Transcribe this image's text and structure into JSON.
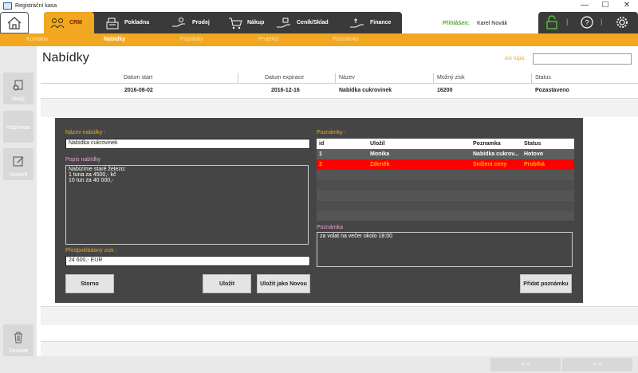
{
  "window": {
    "title": "Registrační kasa",
    "controls": [
      "—",
      "☐",
      "✕"
    ]
  },
  "topnav": {
    "items": [
      {
        "label": "CRM",
        "icon": "people-icon"
      },
      {
        "label": "Pokladna",
        "icon": "cash-register-icon"
      },
      {
        "label": "Prodej",
        "icon": "hand-coin-icon"
      },
      {
        "label": "Nákup",
        "icon": "cart-icon"
      },
      {
        "label": "Ceník/Sklad",
        "icon": "hand-box-icon"
      },
      {
        "label": "Finance",
        "icon": "hand-money-icon"
      }
    ],
    "login_label": "Přihlášen:",
    "login_name": "Karel Novák",
    "separator": "|"
  },
  "subnav": {
    "items": [
      {
        "label": "Kontakty"
      },
      {
        "label": "Nabídky"
      },
      {
        "label": "Poptávky"
      },
      {
        "label": "Projekty"
      },
      {
        "label": "Poznámky"
      }
    ]
  },
  "sidebar": {
    "new_label": "Nový",
    "copy_label": "Kopírovat",
    "edit_label": "Upravit",
    "delete_label": "Smazat"
  },
  "page": {
    "title": "Nabídky",
    "search_label": "ico lupa:",
    "search_value": ""
  },
  "grid": {
    "columns": [
      "Datum start",
      "Datum expirace",
      "Název",
      "Možný zisk",
      "Status"
    ],
    "rows": [
      [
        "2016-08-02",
        "2016-12-16",
        "Nabídka cukrovinek",
        "16200",
        "Pozastaveno"
      ]
    ]
  },
  "dialog": {
    "name_label": "Název nabídky :",
    "name_value": "Nabídka cukrovinek",
    "desc_label": "Popis nabídky",
    "desc_lines": [
      "Nabízíme staré železo:",
      "1 tuna za 4500,- kč",
      "10 tun za 40 000,-"
    ],
    "profit_label": "Předpokládaný zisk :",
    "profit_value": "24 600,- EUR",
    "notes_label": "Poznámky :",
    "notes_columns": [
      "id",
      "Uložil",
      "Poznamka",
      "Status"
    ],
    "notes_rows": [
      [
        "1",
        "Monika",
        "Nabídka cukrov...",
        "Hotovo"
      ],
      [
        "2",
        "Zdeněk",
        "Snížení ceny",
        "Probíhá"
      ]
    ],
    "note_label": "Poznámka",
    "note_value": "za volat na večer okolo 18:00",
    "cancel_label": "Storno",
    "save_label": "Uložit",
    "save_new_label": "Uložit jako Novou",
    "add_note_label": "Přidat poznámku"
  },
  "pager": {
    "prev_label": "< <",
    "next_label": "> >"
  },
  "colors": {
    "accent": "#f1a71f",
    "dark": "#3a3a3a",
    "dialog": "#454545",
    "selected_row": "#ff0000",
    "login_green": "#55a630"
  }
}
